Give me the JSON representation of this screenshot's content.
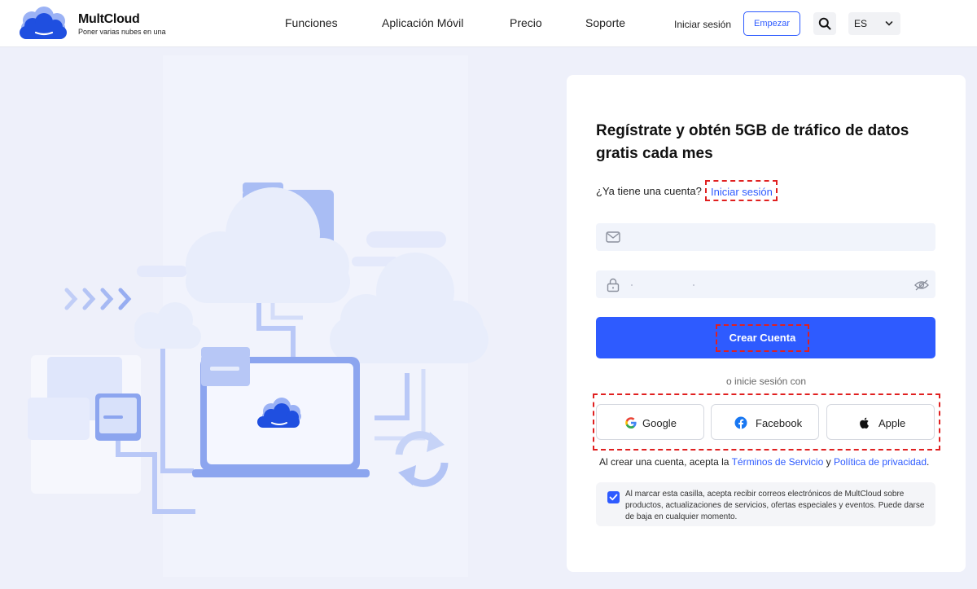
{
  "header": {
    "brand_name": "MultCloud",
    "brand_tagline": "Poner varias nubes en una",
    "nav": [
      "Funciones",
      "Aplicación Móvil",
      "Precio",
      "Soporte"
    ],
    "login_label": "Iniciar sesión",
    "start_label": "Empezar",
    "language": "ES"
  },
  "signup": {
    "title": "Regístrate y obtén 5GB de tráfico de datos gratis cada mes",
    "have_account": "¿Ya tiene una cuenta?",
    "signin_link": "Iniciar sesión",
    "email_value": "",
    "password_value": "",
    "create_button": "Crear Cuenta",
    "or_text": "o inicie sesión con",
    "social": [
      {
        "label": "Google",
        "icon": "google-icon"
      },
      {
        "label": "Facebook",
        "icon": "facebook-icon"
      },
      {
        "label": "Apple",
        "icon": "apple-icon"
      }
    ],
    "terms_prefix": "Al crear una cuenta, acepta la",
    "terms_link": "Términos de Servicio",
    "terms_and": "y",
    "privacy_link": "Política de privacidad",
    "terms_suffix": ".",
    "consent_checked": true,
    "consent_text": "Al marcar esta casilla, acepta recibir correos electrónicos de MultCloud sobre productos, actualizaciones de servicios, ofertas especiales y eventos. Puede darse de baja en cualquier momento."
  },
  "colors": {
    "accent": "#2e5bff",
    "highlight": "#e02020",
    "page_bg": "#eef0fa",
    "input_bg": "#f1f4fb"
  }
}
